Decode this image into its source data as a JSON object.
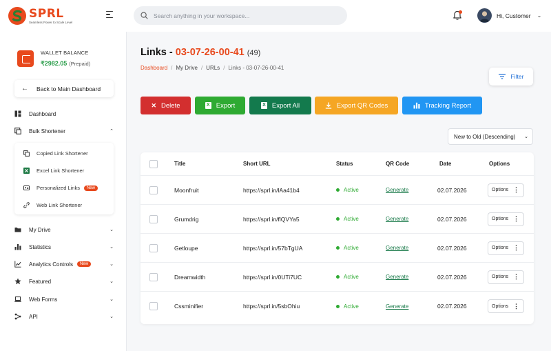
{
  "header": {
    "logo_name": "SPRL",
    "logo_tagline": "Seamless Power to Scale Level",
    "search_placeholder": "Search anything in your workspace...",
    "user_greeting": "Hi, Customer"
  },
  "sidebar": {
    "wallet_label": "WALLET BALANCE",
    "wallet_amount": "₹2982.05",
    "wallet_plan": "(Prepaid)",
    "back_label": "Back to Main Dashboard",
    "items": [
      {
        "label": "Dashboard"
      },
      {
        "label": "Bulk Shortener"
      },
      {
        "label": "My Drive"
      },
      {
        "label": "Statistics"
      },
      {
        "label": "Analytics Controls",
        "badge": "New"
      },
      {
        "label": "Featured"
      },
      {
        "label": "Web Forms"
      },
      {
        "label": "API"
      }
    ],
    "sub_items": [
      {
        "label": "Copied Link Shortener"
      },
      {
        "label": "Excel Link Shortener"
      },
      {
        "label": "Personalized Links",
        "badge": "New"
      },
      {
        "label": "Web Link Shortener"
      }
    ]
  },
  "main": {
    "title_prefix": "Links - ",
    "title_accent": "03-07-26-00-41",
    "title_count": "(49)",
    "breadcrumb": [
      "Dashboard",
      "My Drive",
      "URLs",
      "Links - 03-07-26-00-41"
    ],
    "filter_label": "Filter",
    "actions": {
      "delete": "Delete",
      "export": "Export",
      "export_all": "Export All",
      "export_qr": "Export QR Codes",
      "tracking": "Tracking Report"
    },
    "sort_value": "New to Old (Descending)",
    "table": {
      "headers": [
        "Title",
        "Short URL",
        "Status",
        "QR Code",
        "Date",
        "Options"
      ],
      "rows": [
        {
          "title": "Moonfruit",
          "url": "https://sprl.in/lAa41b4",
          "status": "Active",
          "qr": "Generate",
          "date": "02.07.2026",
          "options": "Options"
        },
        {
          "title": "Grumdrig",
          "url": "https://sprl.in/flQVYa5",
          "status": "Active",
          "qr": "Generate",
          "date": "02.07.2026",
          "options": "Options"
        },
        {
          "title": "Getloupe",
          "url": "https://sprl.in/57bTgUA",
          "status": "Active",
          "qr": "Generate",
          "date": "02.07.2026",
          "options": "Options"
        },
        {
          "title": "Dreamwidth",
          "url": "https://sprl.in/0UTi7UC",
          "status": "Active",
          "qr": "Generate",
          "date": "02.07.2026",
          "options": "Options"
        },
        {
          "title": "Cssminifier",
          "url": "https://sprl.in/5sbOhiu",
          "status": "Active",
          "qr": "Generate",
          "date": "02.07.2026",
          "options": "Options"
        }
      ]
    }
  },
  "colors": {
    "accent": "#e8491d",
    "delete": "#d32f2f",
    "export": "#2eaa32",
    "export_all": "#137a4d",
    "export_qr": "#f5a624",
    "tracking": "#2196f3",
    "active": "#2eaa32"
  }
}
